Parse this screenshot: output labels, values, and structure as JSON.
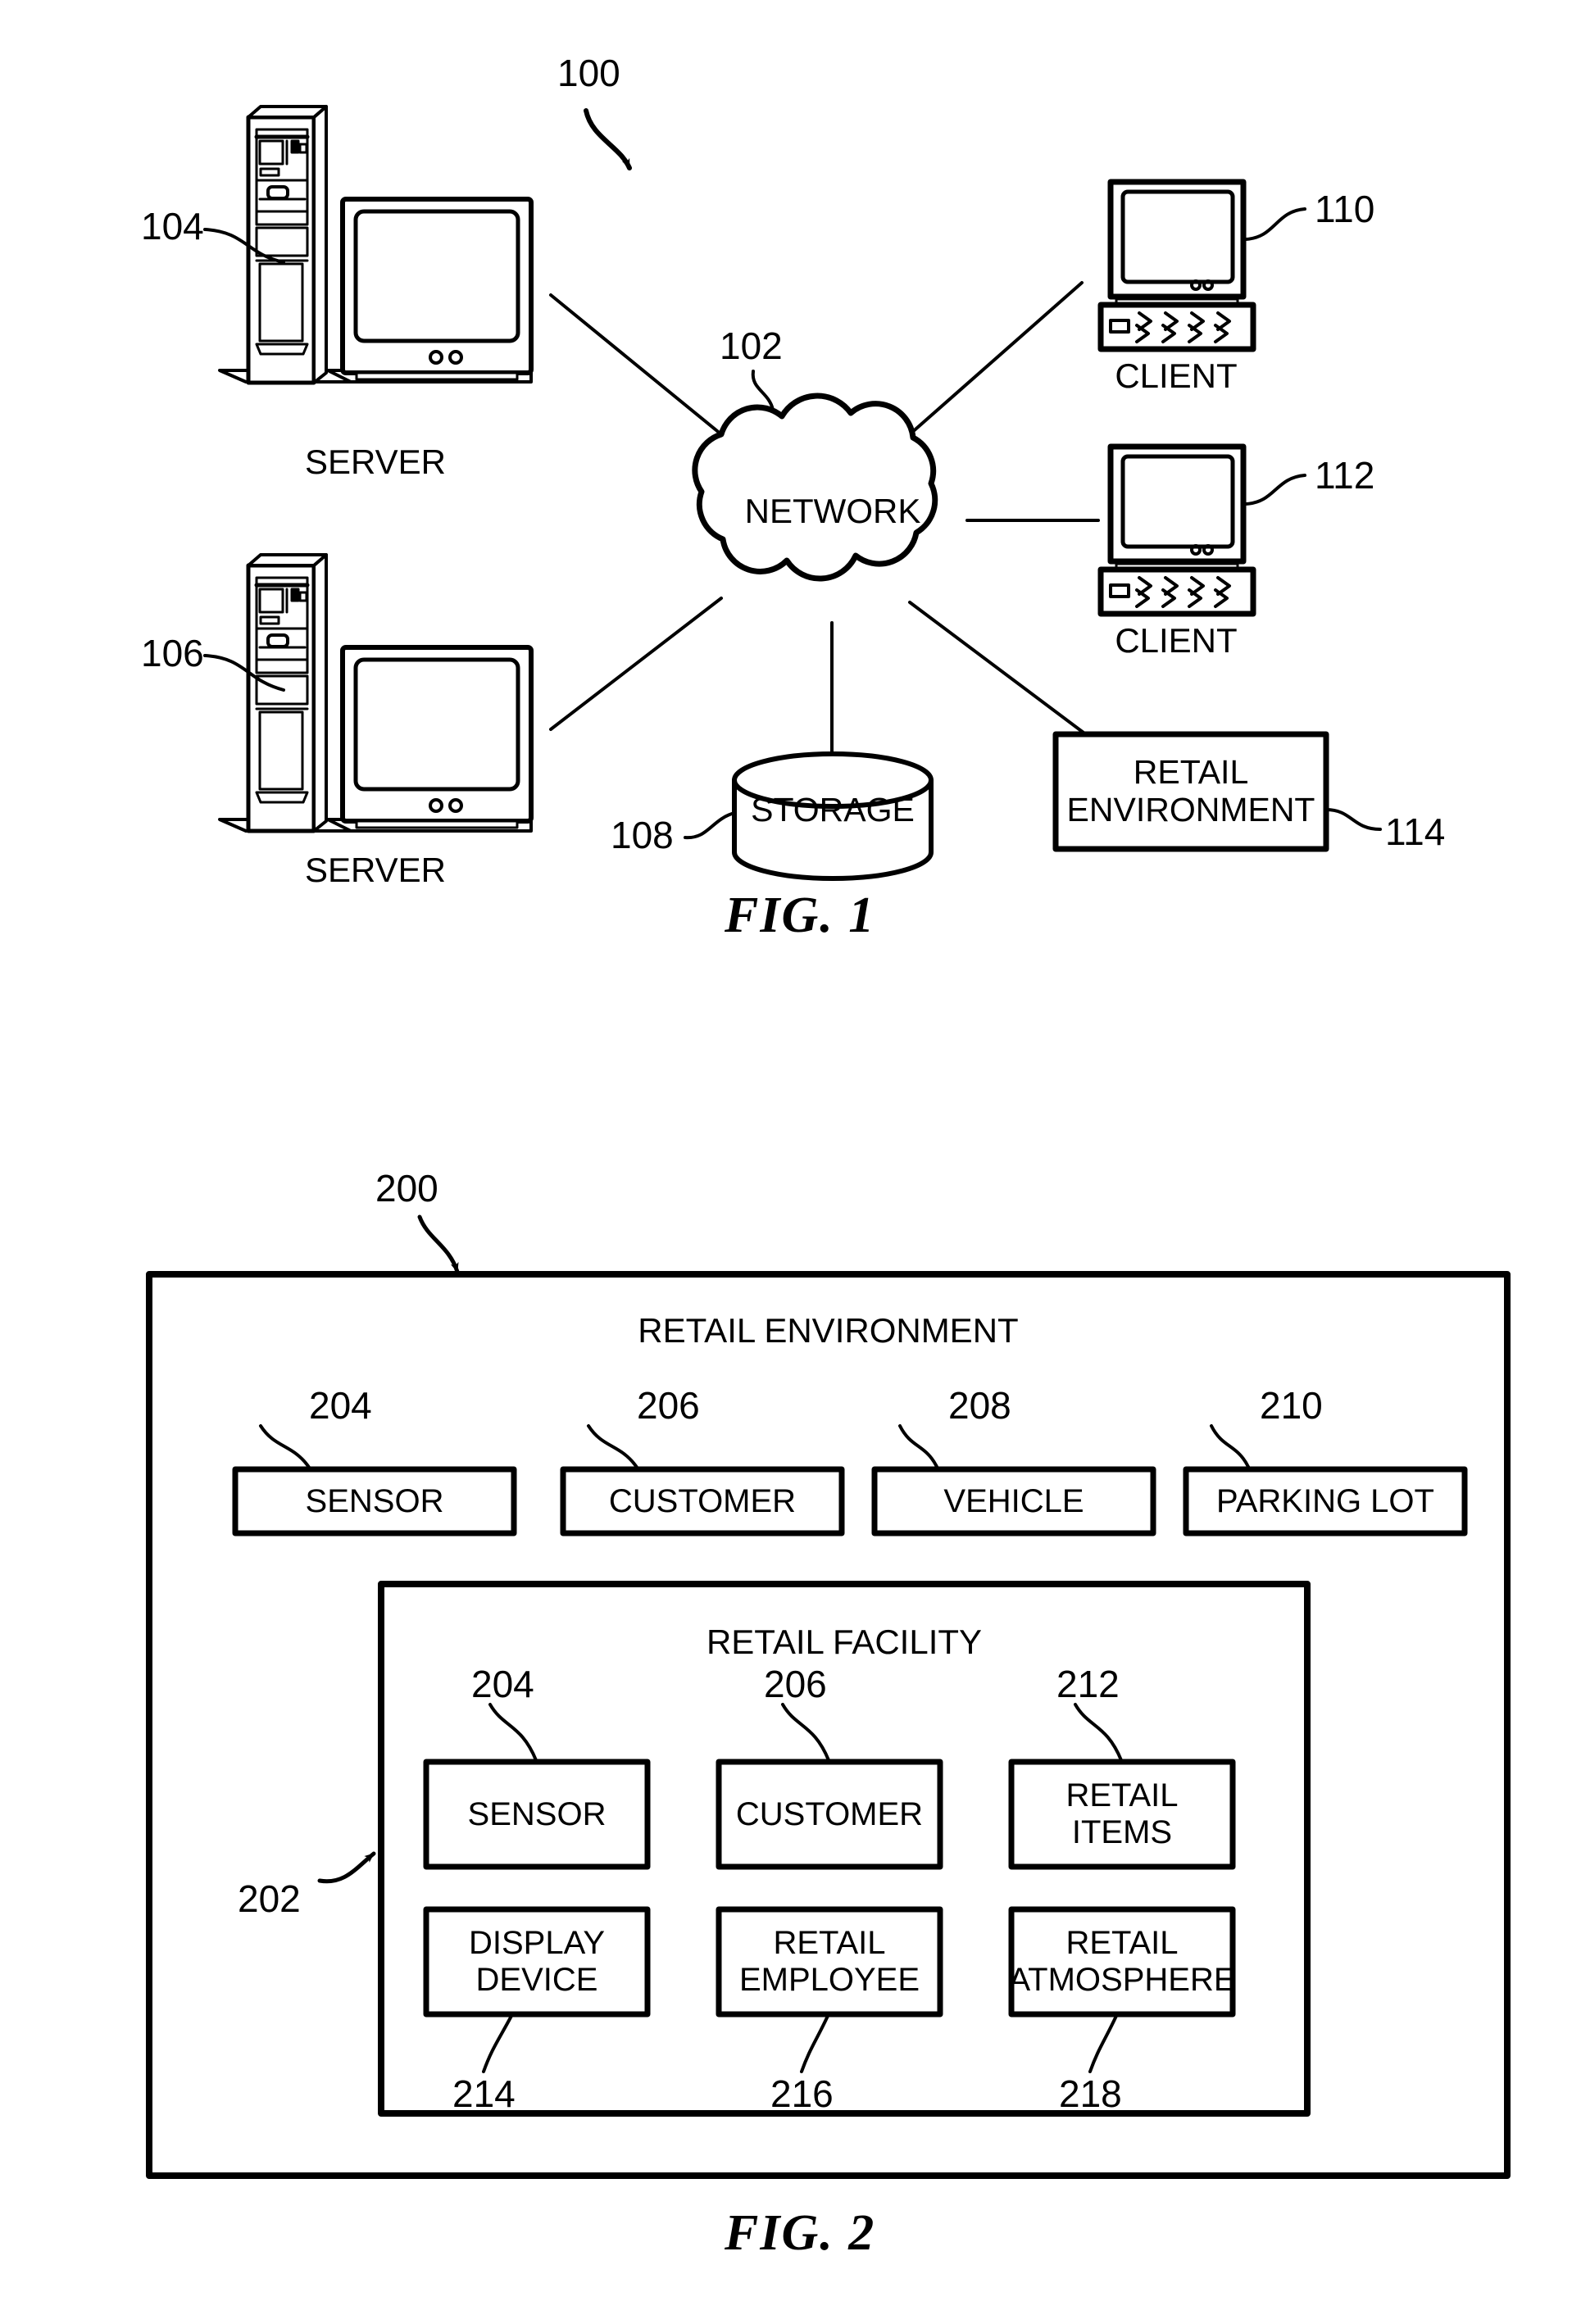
{
  "document": {
    "type": "patent-drawing-sheet",
    "figures": [
      "FIG. 1",
      "FIG. 2"
    ]
  },
  "fig1": {
    "caption": "FIG. 1",
    "system_ref": "100",
    "network": {
      "label": "NETWORK",
      "ref": "102"
    },
    "nodes": [
      {
        "id": "server-top",
        "label": "SERVER",
        "ref": "104",
        "kind": "server-computer"
      },
      {
        "id": "server-bottom",
        "label": "SERVER",
        "ref": "106",
        "kind": "server-computer"
      },
      {
        "id": "client-top",
        "label": "CLIENT",
        "ref": "110",
        "kind": "client-computer"
      },
      {
        "id": "client-bottom",
        "label": "CLIENT",
        "ref": "112",
        "kind": "client-computer"
      },
      {
        "id": "storage",
        "label": "STORAGE",
        "ref": "108",
        "kind": "cylinder"
      },
      {
        "id": "retail-env",
        "label": "RETAIL\nENVIRONMENT",
        "ref": "114",
        "kind": "box"
      }
    ]
  },
  "fig2": {
    "caption": "FIG. 2",
    "outer": {
      "title": "RETAIL ENVIRONMENT",
      "ref": "200"
    },
    "outer_row": [
      {
        "label": "SENSOR",
        "ref": "204"
      },
      {
        "label": "CUSTOMER",
        "ref": "206"
      },
      {
        "label": "VEHICLE",
        "ref": "208"
      },
      {
        "label": "PARKING LOT",
        "ref": "210"
      }
    ],
    "inner": {
      "title": "RETAIL FACILITY",
      "ref": "202"
    },
    "inner_row_top": [
      {
        "label": "SENSOR",
        "ref": "204"
      },
      {
        "label": "CUSTOMER",
        "ref": "206"
      },
      {
        "label": "RETAIL\nITEMS",
        "ref": "212"
      }
    ],
    "inner_row_bottom": [
      {
        "label": "DISPLAY\nDEVICE",
        "ref": "214"
      },
      {
        "label": "RETAIL\nEMPLOYEE",
        "ref": "216"
      },
      {
        "label": "RETAIL\nATMOSPHERE",
        "ref": "218"
      }
    ]
  },
  "colors": {
    "ink": "#000000",
    "paper": "#ffffff"
  }
}
